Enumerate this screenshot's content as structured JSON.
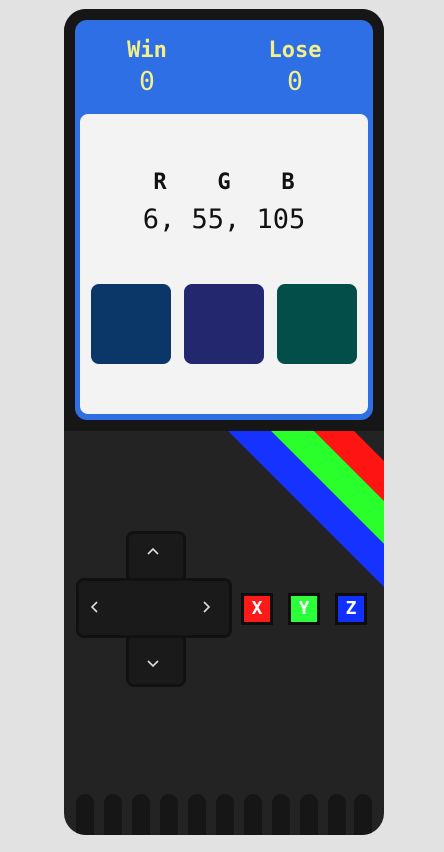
{
  "scores": {
    "win_label": "Win",
    "win_value": "0",
    "lose_label": "Lose",
    "lose_value": "0"
  },
  "rgb": {
    "r_label": "R",
    "g_label": "G",
    "b_label": "B",
    "value_text": "6, 55, 105"
  },
  "choices": [
    {
      "color": "#0b3768"
    },
    {
      "color": "#22276e"
    },
    {
      "color": "#044e4a"
    }
  ],
  "dpad": {
    "up": "^",
    "down": "v",
    "left": "<",
    "right": ">"
  },
  "keys": [
    {
      "label": "X",
      "color": "#ff1a1a"
    },
    {
      "label": "Y",
      "color": "#2bff3a"
    },
    {
      "label": "Z",
      "color": "#1030ff"
    }
  ],
  "stripes": {
    "colors": [
      "#ff1414",
      "#2bff2b",
      "#1532ff"
    ]
  },
  "theme": {
    "screen": "#2f6fe6",
    "score_text": "#f3f08a",
    "body": "#232323"
  }
}
